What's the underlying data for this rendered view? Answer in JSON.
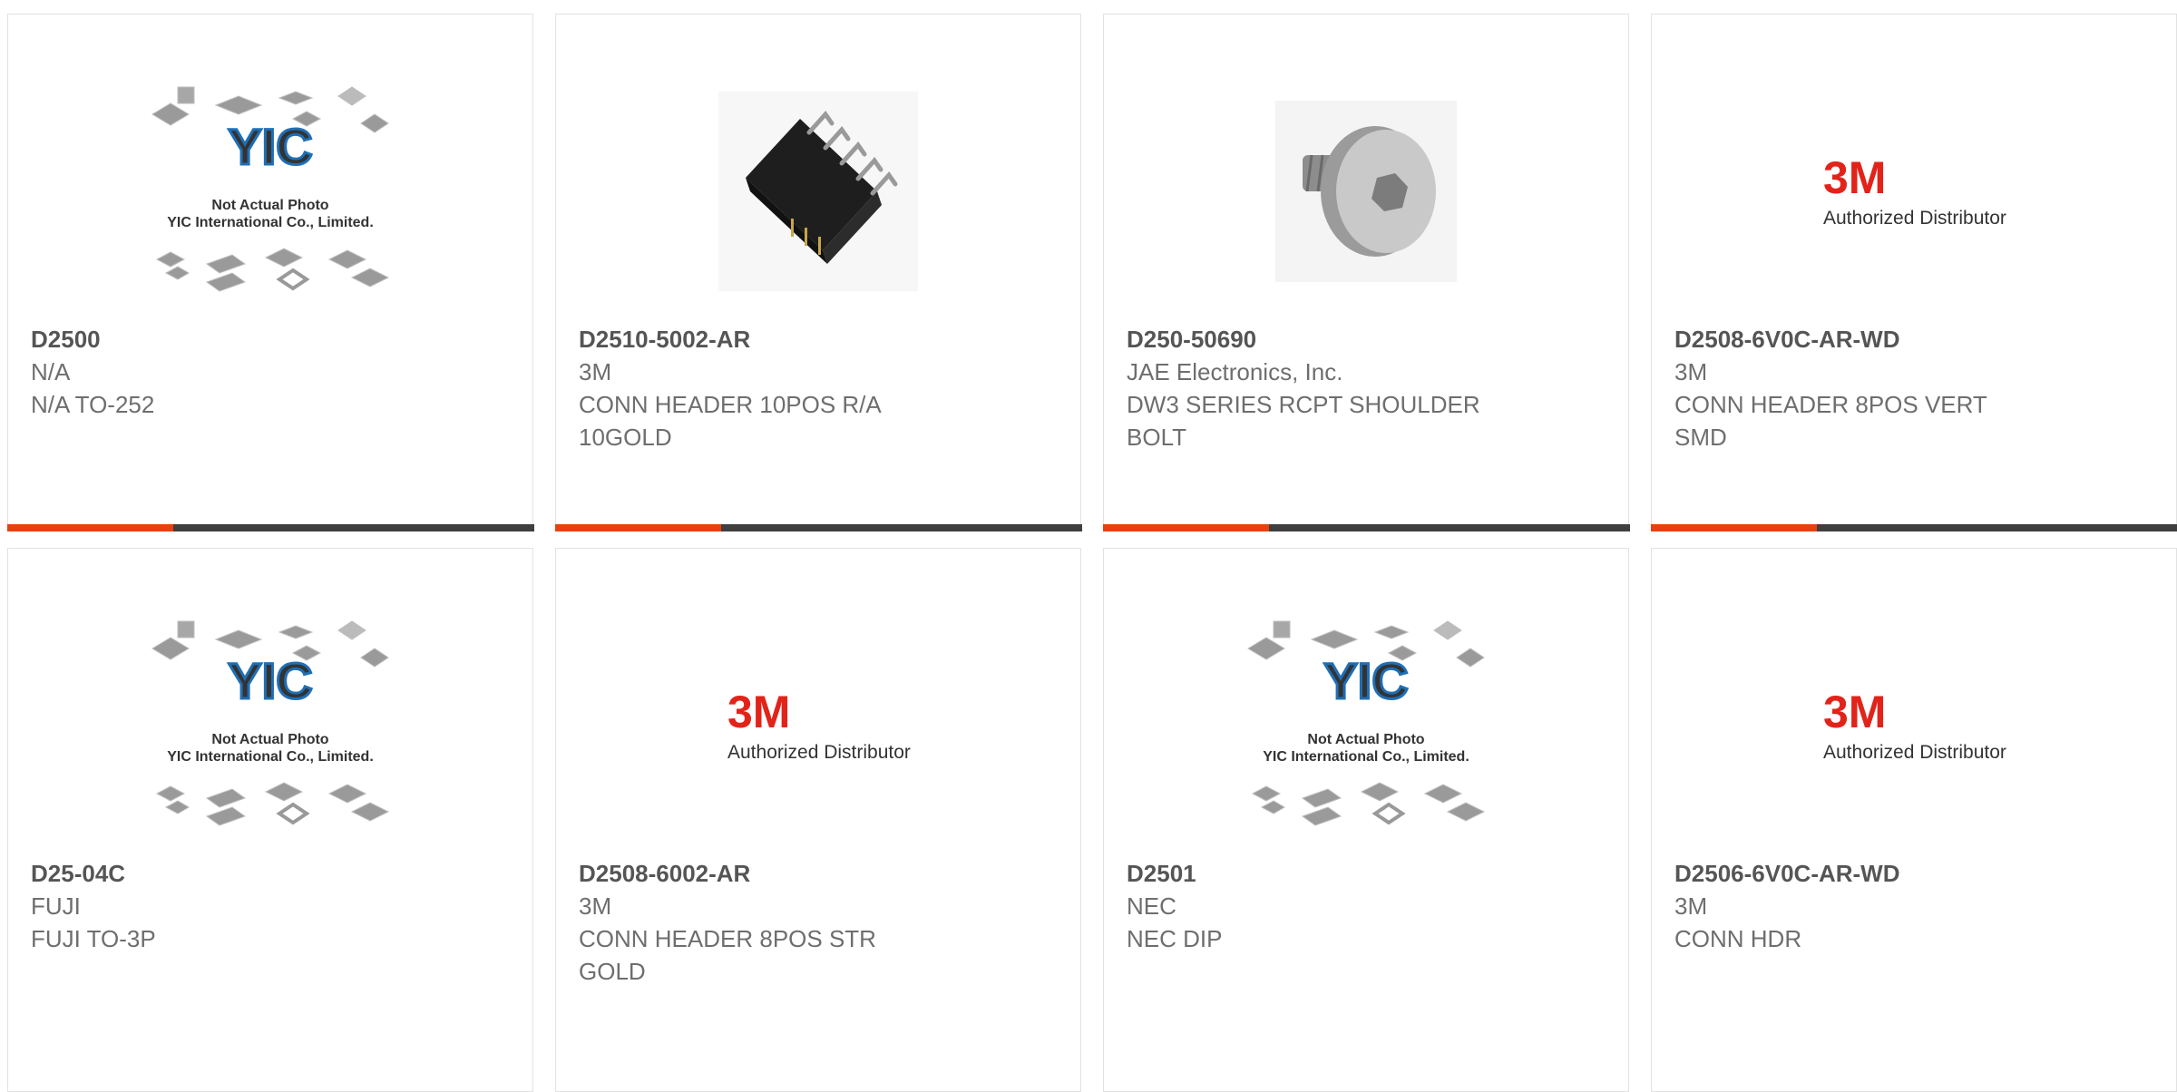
{
  "products": [
    {
      "part": "D2500",
      "manufacturer": "N/A",
      "description": "N/A TO-252",
      "image": "yic"
    },
    {
      "part": "D2510-5002-AR",
      "manufacturer": "3M",
      "description": "CONN HEADER 10POS R/A 10GOLD",
      "image": "header"
    },
    {
      "part": "D250-50690",
      "manufacturer": "JAE Electronics, Inc.",
      "description": "DW3 SERIES RCPT SHOULDER BOLT",
      "image": "bolt"
    },
    {
      "part": "D2508-6V0C-AR-WD",
      "manufacturer": "3M",
      "description": "CONN HEADER 8POS VERT SMD",
      "image": "3m"
    },
    {
      "part": "D25-04C",
      "manufacturer": "FUJI",
      "description": "FUJI TO-3P",
      "image": "yic"
    },
    {
      "part": "D2508-6002-AR",
      "manufacturer": "3M",
      "description": "CONN HEADER 8POS STR GOLD",
      "image": "3m"
    },
    {
      "part": "D2501",
      "manufacturer": "NEC",
      "description": "NEC DIP",
      "image": "yic"
    },
    {
      "part": "D2506-6V0C-AR-WD",
      "manufacturer": "3M",
      "description": "CONN HDR",
      "image": "3m"
    }
  ],
  "yic_placeholder": {
    "brand": "YIC",
    "line1": "Not Actual Photo",
    "line2": "YIC International Co., Limited."
  },
  "brand_3m": {
    "logo": "3M",
    "tagline": "Authorized Distributor"
  },
  "colors": {
    "accent": "#e8410e",
    "bar": "#3f3f3f",
    "logo_red": "#e2231a",
    "yic_blue": "#1f6fb5"
  }
}
